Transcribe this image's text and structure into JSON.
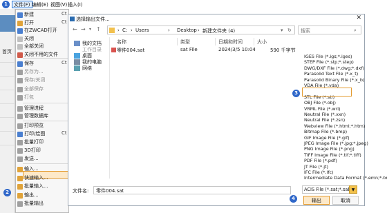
{
  "menubar": {
    "file": "文件(F)",
    "edit": "编辑(E)",
    "view": "视图(V)",
    "insert": "插入(I)"
  },
  "app_strip": {
    "label": "首页"
  },
  "file_menu": {
    "items": [
      {
        "label": "新建",
        "shortcut": "Ct"
      },
      {
        "label": "打开",
        "shortcut": "Ct"
      },
      {
        "label": "在ZWCAD打开",
        "shortcut": ""
      },
      {
        "label": "关闭",
        "shortcut": ""
      },
      {
        "label": "全部关闭",
        "shortcut": ""
      },
      {
        "label": "关闭不用的文件",
        "shortcut": ""
      },
      {
        "label": "保存",
        "shortcut": "Ct"
      },
      {
        "label": "另存为...",
        "shortcut": ""
      },
      {
        "label": "保存/关闭",
        "shortcut": ""
      },
      {
        "label": "全部保存",
        "shortcut": ""
      },
      {
        "label": "打包",
        "shortcut": ""
      },
      {
        "label": "管理进程",
        "shortcut": ""
      },
      {
        "label": "管理数据库",
        "shortcut": ""
      },
      {
        "label": "打印预览",
        "shortcut": ""
      },
      {
        "label": "打印/绘图",
        "shortcut": "Ct"
      },
      {
        "label": "批量打印",
        "shortcut": ""
      },
      {
        "label": "3D打印",
        "shortcut": ""
      },
      {
        "label": "发送...",
        "shortcut": ""
      },
      {
        "label": "输入...",
        "shortcut": ""
      },
      {
        "label": "快速输入...",
        "shortcut": ""
      },
      {
        "label": "批量输入...",
        "shortcut": ""
      },
      {
        "label": "输出...",
        "shortcut": ""
      },
      {
        "label": "批量输出",
        "shortcut": ""
      }
    ]
  },
  "badges": {
    "b1": "1",
    "b2": "2",
    "b3": "3",
    "b4": "4"
  },
  "dialog": {
    "title": "选择输出文件...",
    "close": "✕",
    "address": {
      "drive": "C:",
      "sep1": "›",
      "users": "Users",
      "desktop": "Desktop",
      "folder": "新建文件夹 (4)"
    },
    "search_placeholder": "搜索",
    "nav": {
      "my_docs": "我的文档",
      "recent": "工作目录",
      "desktop": "桌面",
      "my_computer": "我的电脑",
      "network": "网络"
    },
    "columns": {
      "name": "名称",
      "type": "类型",
      "date": "日期和时间",
      "size": "大小"
    },
    "files": [
      {
        "name": "零件004.sat",
        "type": "sat File",
        "date": "2024/3/5 10:04",
        "size": "590 千字节"
      }
    ],
    "file_types": [
      "IGES File (*.igs;*.iges)",
      "STEP File (*.stp;*.step)",
      "DWG/DXF File (*.dwg;*.dxf)",
      "Parasolid Text File (*.x_t)",
      "Parasolid Binary File (*.x_b)",
      "VDA File (*.vda)",
      "ACIS File (*.sat;*.sab)",
      "STL File (*.stl)",
      "OBJ File (*.obj)",
      "VRML File (*.wrl)",
      "Neutral File (*.xxn)",
      "Neutral File (*.zsn)",
      "Webview File (*.html;*.htm)",
      "Bitmap File (*.bmp)",
      "GIF Image File (*.gif)",
      "JPEG Image File (*.jpg;*.jpeg)",
      "PNG Image File (*.png)",
      "TIFF Image File (*.tif;*.tiff)",
      "PDF File (*.pdf)",
      "JT File (*.jt)",
      "IFC File (*.ifc)",
      "Intermediate Data Format (*.emn;*.brd)"
    ],
    "selected_type_index": 6,
    "filename_label": "文件名:",
    "filename_value": "零件004.sat",
    "filetype_value": "ACIS File (*.sat;*.sab)",
    "output_button": "输出",
    "cancel_button": "取消"
  }
}
